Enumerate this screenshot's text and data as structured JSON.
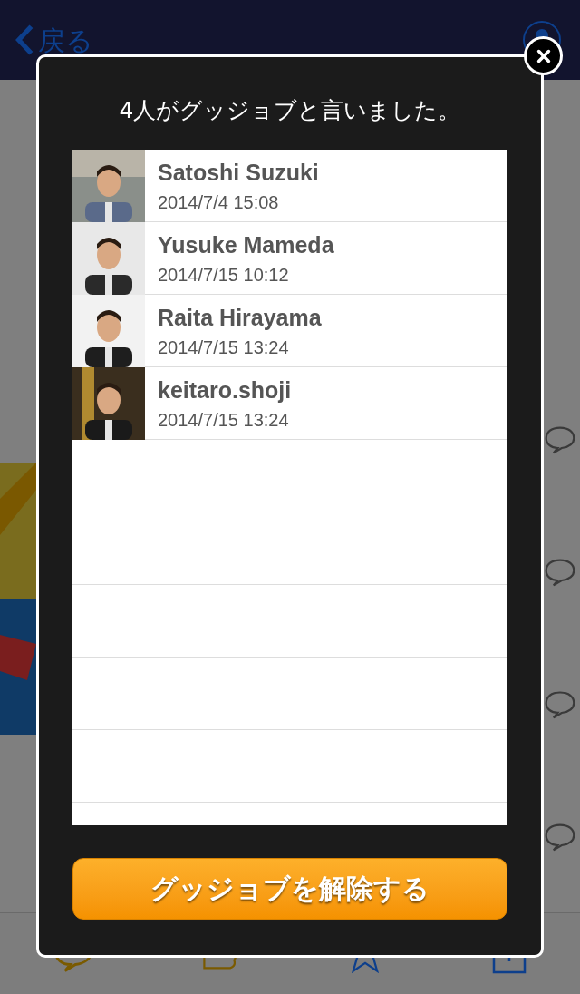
{
  "nav": {
    "back_label": "戻る"
  },
  "dialog": {
    "title": "4人がグッジョブと言いました。",
    "users": [
      {
        "name": "Satoshi Suzuki",
        "time": "2014/7/4 15:08"
      },
      {
        "name": "Yusuke Mameda",
        "time": "2014/7/15 10:12"
      },
      {
        "name": "Raita Hirayama",
        "time": "2014/7/15 13:24"
      },
      {
        "name": "keitaro.shoji",
        "time": "2014/7/15 13:24"
      }
    ],
    "button": "グッジョブを解除する"
  }
}
